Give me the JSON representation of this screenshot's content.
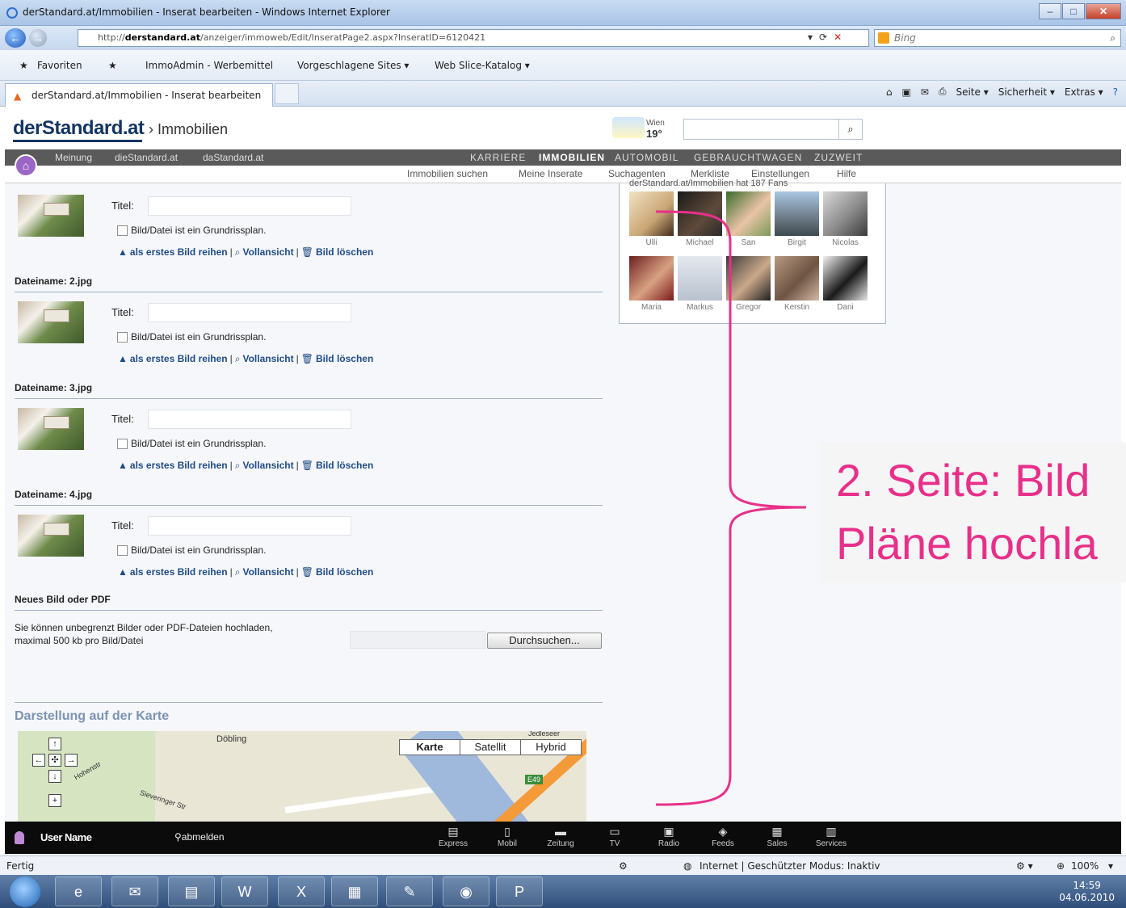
{
  "window": {
    "title": "derStandard.at/Immobilien - Inserat bearbeiten - Windows Internet Explorer"
  },
  "address_bar": {
    "url_prefix": "http://",
    "url_domain": "derstandard.at",
    "url_rest": "/anzeiger/immoweb/Edit/InseratPage2.aspx?InseratID=6120421",
    "search_placeholder": "Bing"
  },
  "favorites_bar": {
    "favorites_label": "Favoriten",
    "items": [
      "ImmoAdmin - Werbemittel",
      "Vorgeschlagene Sites ▾",
      "Web Slice-Katalog ▾"
    ]
  },
  "tab": {
    "title": "derStandard.at/Immobilien - Inserat bearbeiten"
  },
  "command_bar": {
    "items": [
      "Seite ▾",
      "Sicherheit ▾",
      "Extras ▾"
    ]
  },
  "site": {
    "logo": "derStandard.at",
    "breadcrumb": "› Immobilien",
    "weather_city": "Wien",
    "weather_temp": "19°",
    "main_nav_left": [
      "Meinung",
      "dieStandard.at",
      "daStandard.at"
    ],
    "main_nav_right": [
      "KARRIERE",
      "IMMOBILIEN",
      "AUTOMOBIL",
      "GEBRAUCHTWAGEN",
      "ZUZWEIT"
    ],
    "sub_nav": [
      "Immobilien suchen",
      "Meine Inserate",
      "Suchagenten",
      "Merkliste",
      "Einstellungen",
      "Hilfe"
    ]
  },
  "form": {
    "title_label": "Titel:",
    "checkbox_label": "Bild/Datei ist ein Grundrissplan.",
    "action_first": "als erstes Bild reihen",
    "action_full": "Vollansicht",
    "action_delete": "Bild löschen",
    "files": [
      "Dateiname: 2.jpg",
      "Dateiname: 3.jpg",
      "Dateiname: 4.jpg"
    ],
    "new_upload_heading": "Neues Bild oder PDF",
    "upload_hint_line1": "Sie können unbegrenzt Bilder oder PDF-Dateien hochladen,",
    "upload_hint_line2": "maximal 500 kb pro Bild/Datei",
    "browse_button": "Durchsuchen..."
  },
  "map": {
    "heading": "Darstellung auf der Karte",
    "types": [
      "Karte",
      "Satellit",
      "Hybrid"
    ],
    "places": [
      "Döbling",
      "Jedleseer",
      "E49",
      "Hohenstr",
      "Sieveringer Str"
    ]
  },
  "fans": {
    "caption": "derStandard.at/Immobilien hat 187 Fans",
    "names": [
      "Ulli",
      "Michael",
      "San",
      "Birgit",
      "Nicolas",
      "Maria",
      "Markus",
      "Gregor",
      "Kerstin",
      "Dani"
    ]
  },
  "annotation": {
    "line1": "2. Seite: Bild",
    "line2": "Pläne hochla"
  },
  "page_toolbar": {
    "user_name": "User Name",
    "logout": "abmelden",
    "items": [
      "Express",
      "Mobil",
      "Zeitung",
      "TV",
      "Radio",
      "Feeds",
      "Sales",
      "Services"
    ]
  },
  "statusbar": {
    "left": "Fertig",
    "zone": "Internet | Geschützter Modus: Inaktiv",
    "zoom": "100%"
  },
  "taskbar": {
    "time": "14:59",
    "date": "04.06.2010"
  },
  "colors": {
    "annotation": "#e8308a",
    "logo": "#12355f",
    "nav_bg": "#5a5a5a"
  }
}
